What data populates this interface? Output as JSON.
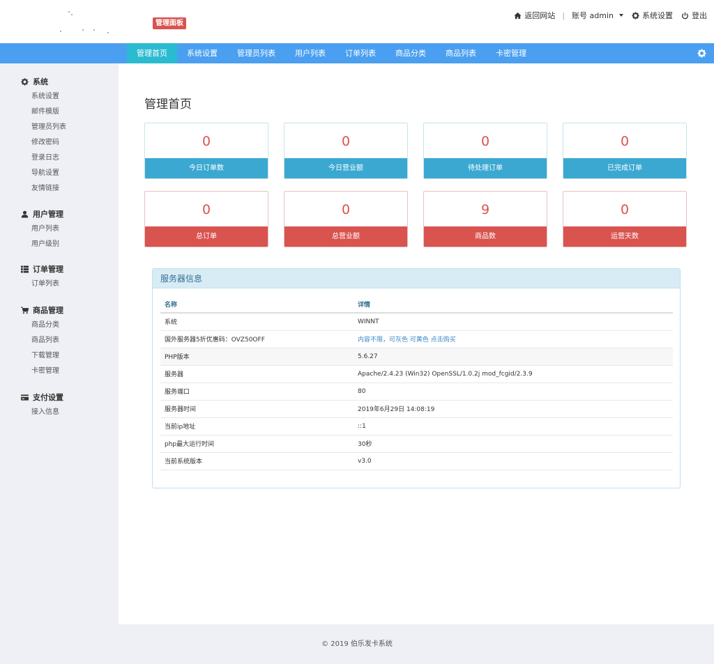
{
  "header": {
    "badge": "管理面板",
    "links": {
      "home": "返回网站",
      "account": "账号 admin",
      "settings": "系统设置",
      "logout": "登出"
    }
  },
  "nav": {
    "items": [
      "管理首页",
      "系统设置",
      "管理员列表",
      "用户列表",
      "订单列表",
      "商品分类",
      "商品列表",
      "卡密管理"
    ],
    "active_index": 0
  },
  "sidebar": {
    "groups": [
      {
        "title": "系统",
        "icon": "gear-icon",
        "links": [
          "系统设置",
          "邮件模版",
          "管理员列表",
          "修改密码",
          "登录日志",
          "导航设置",
          "友情链接"
        ]
      },
      {
        "title": "用户管理",
        "icon": "user-icon",
        "links": [
          "用户列表",
          "用户级别"
        ]
      },
      {
        "title": "订单管理",
        "icon": "list-icon",
        "links": [
          "订单列表"
        ]
      },
      {
        "title": "商品管理",
        "icon": "cart-icon",
        "links": [
          "商品分类",
          "商品列表",
          "下载管理",
          "卡密管理"
        ]
      },
      {
        "title": "支付设置",
        "icon": "card-icon",
        "links": [
          "接入信息"
        ]
      }
    ]
  },
  "main": {
    "title": "管理首页",
    "cards": [
      {
        "value": "0",
        "label": "今日订单数",
        "color": "blue"
      },
      {
        "value": "0",
        "label": "今日营业额",
        "color": "blue"
      },
      {
        "value": "0",
        "label": "待处理订单",
        "color": "blue"
      },
      {
        "value": "0",
        "label": "已完成订单",
        "color": "blue"
      },
      {
        "value": "0",
        "label": "总订单",
        "color": "red"
      },
      {
        "value": "0",
        "label": "总营业额",
        "color": "red"
      },
      {
        "value": "9",
        "label": "商品数",
        "color": "red"
      },
      {
        "value": "0",
        "label": "运营天数",
        "color": "red"
      }
    ]
  },
  "server": {
    "title": "服务器信息",
    "columns": [
      "名称",
      "详情"
    ],
    "rows": [
      {
        "name": "系统",
        "value": "WINNT"
      },
      {
        "name": "国外服务器5折优惠码：OVZ50OFF",
        "value": "内容不限，可灰色 可黄色 点击购买",
        "link": true
      },
      {
        "name": "PHP版本",
        "value": "5.6.27"
      },
      {
        "name": "服务器",
        "value": "Apache/2.4.23 (Win32) OpenSSL/1.0.2j mod_fcgid/2.3.9"
      },
      {
        "name": "服务端口",
        "value": "80"
      },
      {
        "name": "服务器时间",
        "value": "2019年6月29日 14:08:19"
      },
      {
        "name": "当前ip地址",
        "value": "::1"
      },
      {
        "name": "php最大运行时间",
        "value": "30秒"
      },
      {
        "name": "当前系统版本",
        "value": "v3.0"
      }
    ]
  },
  "footer": {
    "text": "©  2019 伯乐发卡系统"
  },
  "colors": {
    "nav": "#4a9ff0",
    "nav_active": "#2bbbd0",
    "card_blue": "#3ba8d1",
    "card_red": "#d9534f",
    "sidebar_bg": "#eef0f5"
  }
}
